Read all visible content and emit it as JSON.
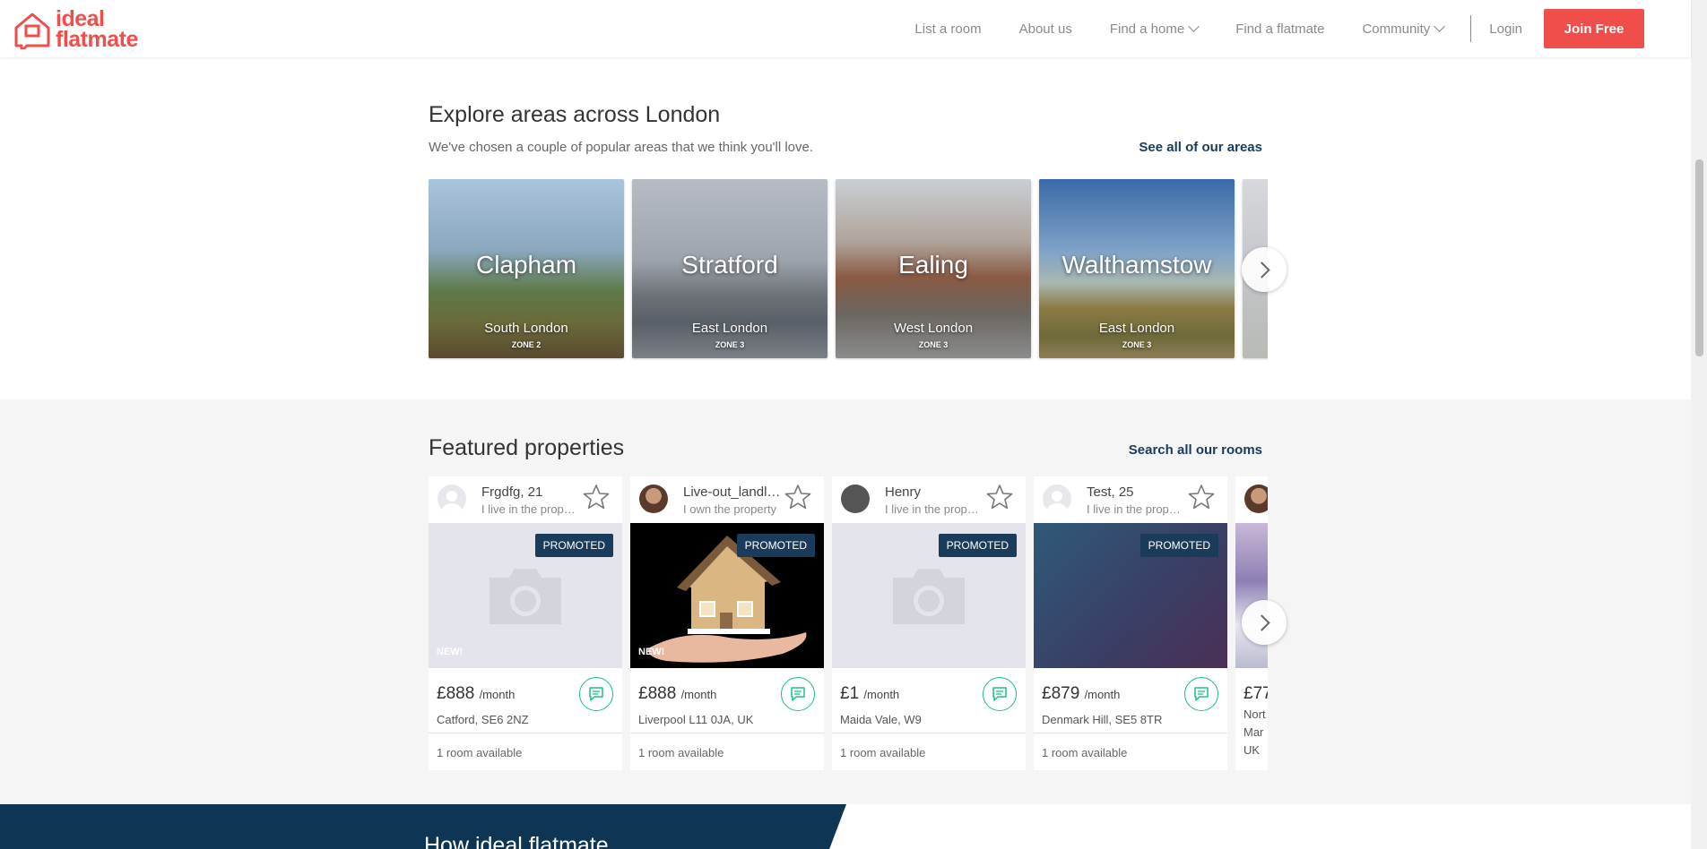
{
  "header": {
    "logo_line1": "ideal",
    "logo_line2": "flatmate",
    "nav": {
      "list_room": "List a room",
      "about": "About us",
      "find_home": "Find a home",
      "find_flatmate": "Find a flatmate",
      "community": "Community",
      "login": "Login",
      "join": "Join Free"
    },
    "accent_color": "#f04e4b"
  },
  "areas": {
    "title": "Explore areas across London",
    "subtitle": "We've chosen a couple of popular areas that we think you'll love.",
    "see_all": "See all of our areas",
    "cards": [
      {
        "name": "Clapham",
        "region": "South London",
        "zone": "ZONE 2"
      },
      {
        "name": "Stratford",
        "region": "East London",
        "zone": "ZONE 3"
      },
      {
        "name": "Ealing",
        "region": "West London",
        "zone": "ZONE 3"
      },
      {
        "name": "Walthamstow",
        "region": "East London",
        "zone": "ZONE 3"
      }
    ]
  },
  "featured": {
    "title": "Featured properties",
    "see_all": "Search all our rooms",
    "cards": [
      {
        "name": "Frgdfg, 21",
        "role": "I live in the property",
        "promoted": "PROMOTED",
        "new": "NEW!",
        "price": "£888",
        "per": "/month",
        "address": "Catford, SE6 2NZ",
        "availability": "1 room available"
      },
      {
        "name": "Live-out_landlord",
        "role": "I own the property",
        "promoted": "PROMOTED",
        "new": "NEW!",
        "price": "£888",
        "per": "/month",
        "address": "Liverpool L11 0JA, UK",
        "availability": "1 room available"
      },
      {
        "name": "Henry",
        "role": "I live in the property",
        "promoted": "PROMOTED",
        "price": "£1",
        "per": "/month",
        "address": "Maida Vale, W9",
        "availability": "1 room available"
      },
      {
        "name": "Test, 25",
        "role": "I live in the property",
        "promoted": "PROMOTED",
        "price": "£879",
        "per": "/month",
        "address": "Denmark Hill, SE5 8TR",
        "availability": "1 room available"
      },
      {
        "price": "£77",
        "address_lines": [
          "Nort",
          "Mar",
          "UK"
        ]
      }
    ]
  },
  "banner": {
    "title": "How ideal flatmate"
  }
}
